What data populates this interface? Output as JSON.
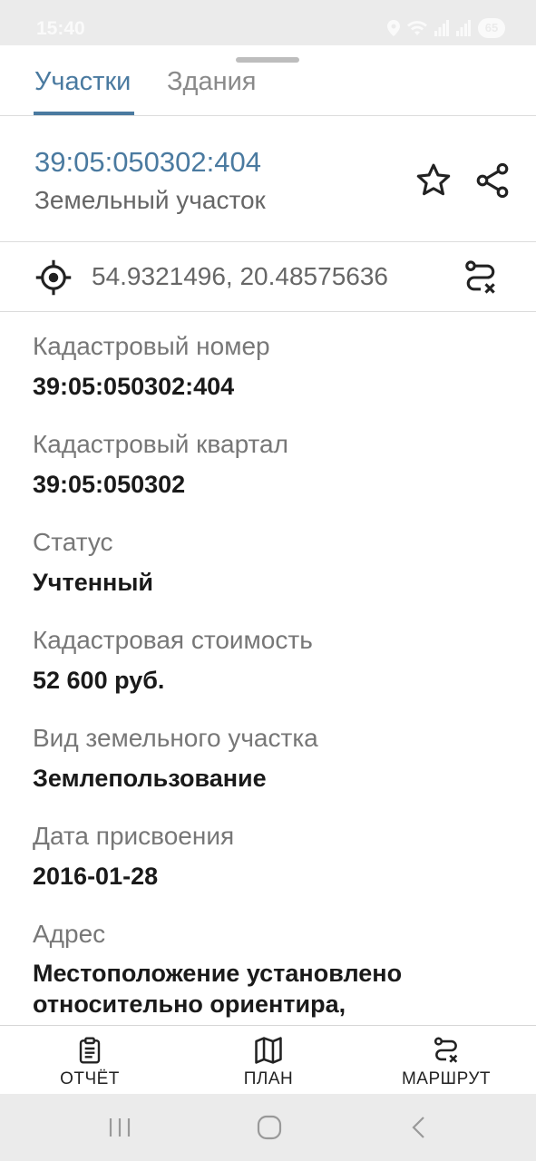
{
  "status_bar": {
    "time": "15:40",
    "battery": "65",
    "icons": [
      "location-icon",
      "wifi-icon",
      "signal-icon",
      "signal-icon",
      "battery-icon"
    ]
  },
  "tabs": [
    {
      "label": "Участки",
      "active": true
    },
    {
      "label": "Здания",
      "active": false
    }
  ],
  "header": {
    "parcel_id": "39:05:050302:404",
    "parcel_type": "Земельный участок",
    "actions": [
      "star-icon",
      "share-icon"
    ]
  },
  "coordinates": {
    "text": "54.9321496, 20.48575636",
    "icon": "crosshair-icon",
    "action_icon": "route-cancel-icon"
  },
  "fields": [
    {
      "label": "Кадастровый номер",
      "value": "39:05:050302:404"
    },
    {
      "label": "Кадастровый квартал",
      "value": "39:05:050302"
    },
    {
      "label": "Статус",
      "value": "Учтенный"
    },
    {
      "label": "Кадастровая стоимость",
      "value": "52 600 руб."
    },
    {
      "label": "Вид земельного участка",
      "value": "Землепользование"
    },
    {
      "label": "Дата присвоения",
      "value": "2016-01-28"
    },
    {
      "label": "Адрес",
      "value_line1": "Местоположение установлено",
      "value_line2": "относительно ориентира,"
    }
  ],
  "bottom_nav": [
    {
      "label": "ОТЧЁТ",
      "icon": "clipboard-icon"
    },
    {
      "label": "ПЛАН",
      "icon": "map-icon"
    },
    {
      "label": "МАРШРУТ",
      "icon": "route-icon"
    }
  ],
  "system_nav": [
    "recent-apps-icon",
    "home-icon",
    "back-icon"
  ],
  "colors": {
    "accent": "#4a7aa0",
    "label": "#777777",
    "value": "#1a1a1a",
    "divider": "#dcdcdc"
  }
}
